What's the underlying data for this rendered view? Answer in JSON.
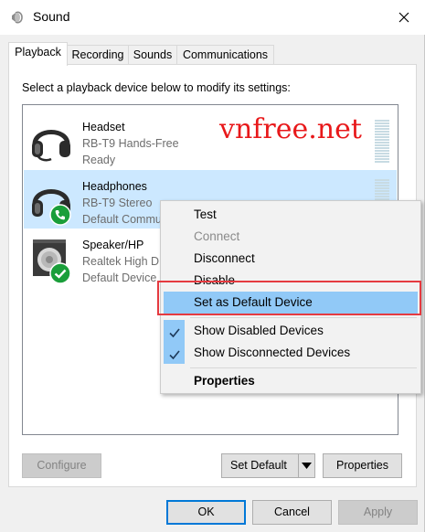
{
  "window": {
    "title": "Sound"
  },
  "tabs": [
    {
      "label": "Playback",
      "active": true
    },
    {
      "label": "Recording",
      "active": false
    },
    {
      "label": "Sounds",
      "active": false
    },
    {
      "label": "Communications",
      "active": false
    }
  ],
  "instruction": "Select a playback device below to modify its settings:",
  "devices": [
    {
      "name": "Headset",
      "description": "RB-T9 Hands-Free",
      "status": "Ready",
      "icon": "headset-icon",
      "selected": false
    },
    {
      "name": "Headphones",
      "description": "RB-T9 Stereo",
      "status": "Default Commu",
      "icon": "headphones-icon",
      "badge": "phone-badge-icon",
      "selected": true
    },
    {
      "name": "Speaker/HP",
      "description": "Realtek High D",
      "status": "Default Device",
      "icon": "speaker-icon",
      "badge": "checkmark-badge-icon",
      "selected": false
    }
  ],
  "watermark": "vnfree.net",
  "context_menu": {
    "items": [
      {
        "label": "Test",
        "enabled": true
      },
      {
        "label": "Connect",
        "enabled": false
      },
      {
        "label": "Disconnect",
        "enabled": true
      },
      {
        "label": "Disable",
        "enabled": true
      },
      {
        "label": "Set as Default Device",
        "enabled": true,
        "hovered": true,
        "highlighted": true
      },
      {
        "label": "Show Disabled Devices",
        "checked": true
      },
      {
        "label": "Show Disconnected Devices",
        "checked": true
      },
      {
        "label": "Properties",
        "bold": true
      }
    ]
  },
  "panel_buttons": {
    "configure": "Configure",
    "set_default": "Set Default",
    "properties": "Properties"
  },
  "dialog_buttons": {
    "ok": "OK",
    "cancel": "Cancel",
    "apply": "Apply"
  },
  "colors": {
    "accent": "#0078d7",
    "selection": "#cce8ff",
    "menu_hover": "#91c9f7",
    "highlight_box": "#e53a40",
    "watermark": "#e8181a",
    "badge_green": "#1a9e3a"
  }
}
